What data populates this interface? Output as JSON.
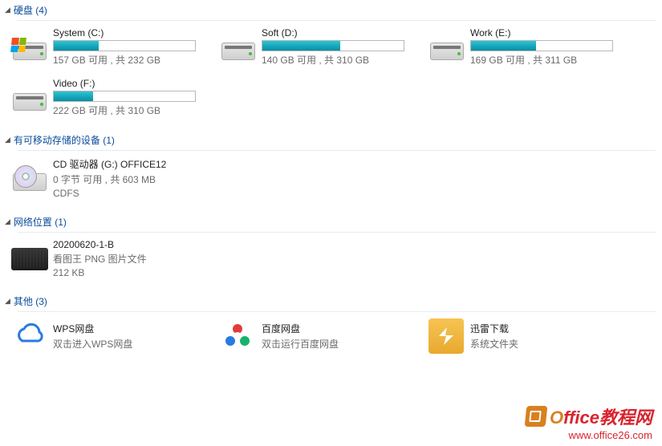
{
  "sections": {
    "drives": {
      "title": "硬盘 (4)"
    },
    "removable": {
      "title": "有可移动存储的设备 (1)"
    },
    "network": {
      "title": "网络位置 (1)"
    },
    "other": {
      "title": "其他 (3)"
    }
  },
  "drives": [
    {
      "name": "System (C:)",
      "status": "157 GB 可用 , 共 232 GB",
      "fill": 32,
      "win": true
    },
    {
      "name": "Soft (D:)",
      "status": "140 GB 可用 , 共 310 GB",
      "fill": 55,
      "win": false
    },
    {
      "name": "Work (E:)",
      "status": "169 GB 可用 , 共 311 GB",
      "fill": 46,
      "win": false
    },
    {
      "name": "Video (F:)",
      "status": "222 GB 可用 , 共 310 GB",
      "fill": 28,
      "win": false
    }
  ],
  "removable": [
    {
      "name": "CD 驱动器 (G:) OFFICE12",
      "status": "0 字节 可用 , 共 603 MB",
      "fs": "CDFS"
    }
  ],
  "network": [
    {
      "name": "20200620-1-B",
      "desc": "看图王 PNG 图片文件",
      "size": "212 KB"
    }
  ],
  "other": [
    {
      "name": "WPS网盘",
      "desc": "双击进入WPS网盘",
      "icon": "wps"
    },
    {
      "name": "百度网盘",
      "desc": "双击运行百度网盘",
      "icon": "baidu"
    },
    {
      "name": "迅雷下载",
      "desc": "系统文件夹",
      "icon": "xunlei"
    }
  ],
  "watermark": {
    "brand_o": "O",
    "brand_rest": "ffice教程网",
    "url": "www.office26.com"
  }
}
